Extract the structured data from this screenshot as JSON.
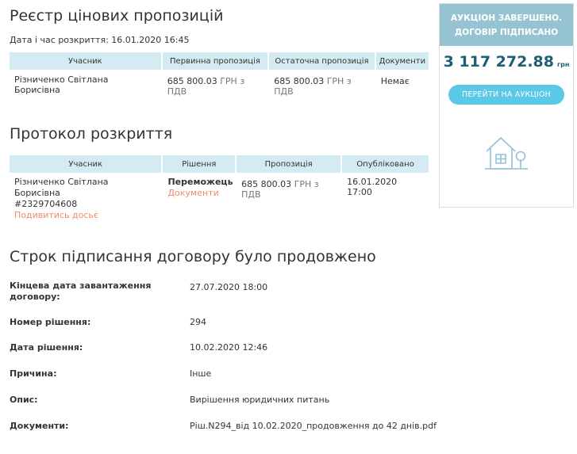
{
  "registry": {
    "title": "Реєстр цінових пропозицій",
    "opened_label": "Дата і час розкриття:",
    "opened_value": "16.01.2020 16:45",
    "headers": [
      "Учасник",
      "Первинна пропозиція",
      "Остаточна пропозиція",
      "Документи"
    ],
    "row": {
      "participant": "Різниченко Світлана Борисівна",
      "initial_amount": "685 800.03",
      "initial_unit": "ГРН з ПДВ",
      "final_amount": "685 800.03",
      "final_unit": "ГРН з ПДВ",
      "documents": "Немає"
    }
  },
  "protocol": {
    "title": "Протокол розкриття",
    "headers": [
      "Учасник",
      "Рішення",
      "Пропозиція",
      "Опубліковано"
    ],
    "row": {
      "participant": "Різниченко Світлана Борисівна",
      "participant_id": "#2329704608",
      "dossier_link": "Подивитись досьє",
      "decision": "Переможець",
      "decision_docs": "Документи",
      "amount": "685 800.03",
      "unit": "ГРН з ПДВ",
      "published": "16.01.2020 17:00"
    }
  },
  "extension": {
    "title": "Строк підписання договору було продовжено",
    "rows": [
      {
        "label": "Кінцева дата завантаження договору:",
        "value": "27.07.2020 18:00"
      },
      {
        "label": "Номер рішення:",
        "value": "294"
      },
      {
        "label": "Дата рішення:",
        "value": "10.02.2020 12:46"
      },
      {
        "label": "Причина:",
        "value": "Інше"
      },
      {
        "label": "Опис:",
        "value": "Вирішення юридичних питань"
      },
      {
        "label": "Документи:",
        "value": "Ріш.N294_від 10.02.2020_продовження до 42 днів.pdf"
      }
    ]
  },
  "sidebar": {
    "status_line1": "АУКЦІОН ЗАВЕРШЕНО.",
    "status_line2": "ДОГОВІР ПІДПИСАНО",
    "amount": "3 117 272.88",
    "currency": "грн",
    "button_label": "ПЕРЕЙТИ НА АУКЦІОН",
    "icon": "house-icon"
  },
  "colors": {
    "header_bg": "#d4ebf4",
    "status_bg": "#96c3d2",
    "button_bg": "#5bc8e8",
    "link": "#f08a6c",
    "amount": "#1d5f73"
  }
}
